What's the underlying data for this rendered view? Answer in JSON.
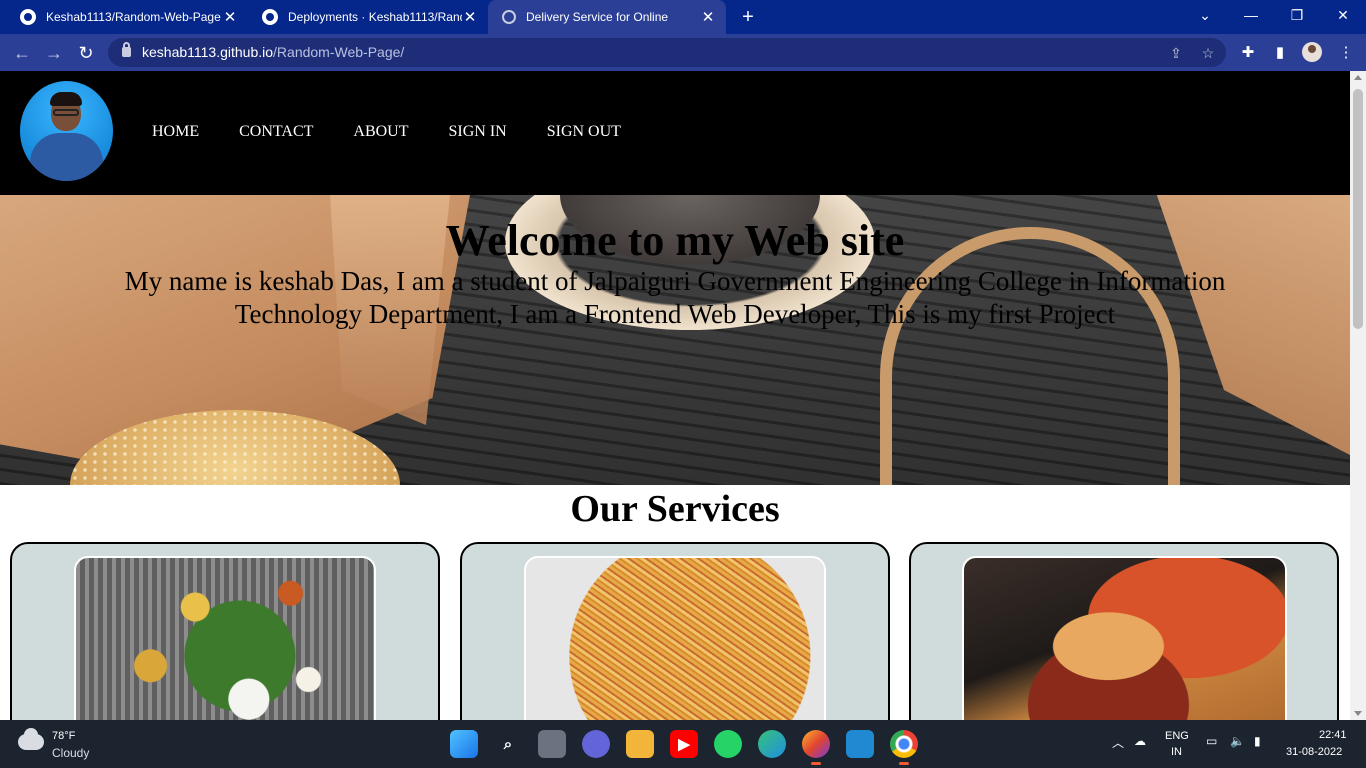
{
  "browser": {
    "tabs": [
      {
        "title": "Keshab1113/Random-Web-Page",
        "icon": "github-icon",
        "active": false
      },
      {
        "title": "Deployments · Keshab1113/Random-Web-Page",
        "icon": "github-icon",
        "active": false
      },
      {
        "title": "Delivery Service for Online",
        "icon": "globe-icon",
        "active": true
      }
    ],
    "new_tab": "+",
    "url_host": "keshab1113.github.io",
    "url_path": "/Random-Web-Page/",
    "window_controls": {
      "tab_search": "⌄",
      "minimize": "—",
      "restore": "❐",
      "close": "✕"
    },
    "colors": {
      "tabstrip": "#05268a",
      "toolbar": "#2c3f96"
    }
  },
  "site": {
    "nav": {
      "links": [
        "HOME",
        "CONTACT",
        "ABOUT",
        "SIGN IN",
        "SIGN OUT"
      ]
    },
    "hero": {
      "title": "Welcome to my Web site",
      "text": "My name is keshab Das, I am a student of Jalpaiguri Government Engineering College in Information Technology Department, I am a Frontend Web Developer, This is my first Project"
    },
    "services": {
      "title": "Our Services",
      "cards": [
        {
          "image": "thali-image"
        },
        {
          "image": "noodles-image"
        },
        {
          "image": "burger-pizza-image"
        }
      ]
    }
  },
  "taskbar": {
    "weather": {
      "temp": "78°F",
      "desc": "Cloudy"
    },
    "apps": [
      "start",
      "search",
      "task-view",
      "teams-chat",
      "file-explorer",
      "youtube",
      "whatsapp",
      "edge",
      "firefox",
      "vscode",
      "chrome"
    ],
    "tray": {
      "lang_top": "ENG",
      "lang_bottom": "IN"
    },
    "clock": {
      "time": "22:41",
      "date": "31-08-2022"
    }
  }
}
